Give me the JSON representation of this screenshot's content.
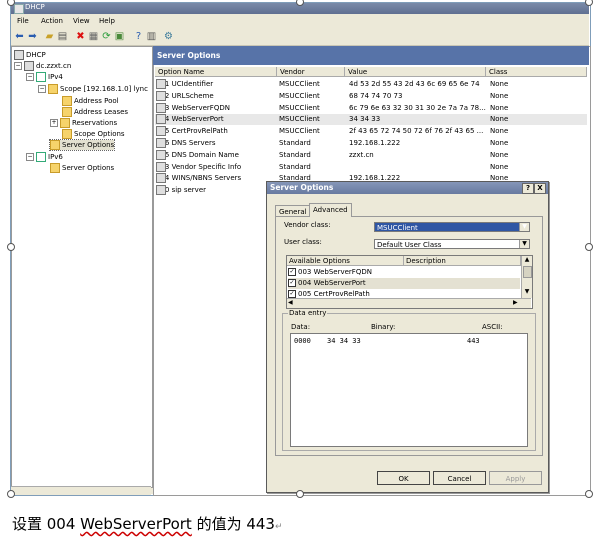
{
  "window": {
    "title": "DHCP"
  },
  "menu": [
    "File",
    "Action",
    "View",
    "Help"
  ],
  "toolbar_icons": [
    "back-arrow-icon",
    "forward-arrow-icon",
    "up-folder-icon",
    "show-hide-tree-icon",
    "delete-icon",
    "properties-icon",
    "refresh-icon",
    "export-icon",
    "help-icon",
    "console-icon",
    "options-icon"
  ],
  "tree": {
    "root": "DHCP",
    "server": "dc.zzxt.cn",
    "ipv4": "IPv4",
    "scope": "Scope [192.168.1.0] lync",
    "address_pool": "Address Pool",
    "address_leases": "Address Leases",
    "reservations": "Reservations",
    "scope_options": "Scope Options",
    "server_options_v4": "Server Options",
    "ipv6": "IPv6",
    "server_options_v6": "Server Options"
  },
  "pane": {
    "title": "Server Options",
    "columns": [
      "Option Name",
      "Vendor",
      "Value",
      "Class"
    ],
    "rows": [
      {
        "name": "001 UCIdentifier",
        "vendor": "MSUCClient",
        "value": "4d 53 2d 55 43 2d 43 6c 69 65 6e 74",
        "class": "None"
      },
      {
        "name": "002 URLScheme",
        "vendor": "MSUCClient",
        "value": "68 74 74 70 73",
        "class": "None"
      },
      {
        "name": "003 WebServerFQDN",
        "vendor": "MSUCClient",
        "value": "6c 79 6e 63 32 30 31 30 2e 7a 7a 78...",
        "class": "None"
      },
      {
        "name": "004 WebServerPort",
        "vendor": "MSUCClient",
        "value": "34 34 33",
        "class": "None"
      },
      {
        "name": "005 CertProvRelPath",
        "vendor": "MSUCClient",
        "value": "2f 43 65 72 74 50 72 6f 76 2f 43 65 ...",
        "class": "None"
      },
      {
        "name": "006 DNS Servers",
        "vendor": "Standard",
        "value": "192.168.1.222",
        "class": "None"
      },
      {
        "name": "015 DNS Domain Name",
        "vendor": "Standard",
        "value": "zzxt.cn",
        "class": "None"
      },
      {
        "name": "043 Vendor Specific Info",
        "vendor": "Standard",
        "value": "",
        "class": "None"
      },
      {
        "name": "044 WINS/NBNS Servers",
        "vendor": "Standard",
        "value": "192.168.1.222",
        "class": "None"
      },
      {
        "name": "120 sip server",
        "vendor": "",
        "value": "",
        "class": ""
      }
    ]
  },
  "dialog": {
    "title": "Server Options",
    "help_btn": "?",
    "close_btn": "X",
    "tabs": [
      "General",
      "Advanced"
    ],
    "vendor_class_label": "Vendor class:",
    "vendor_class_value": "MSUCClient",
    "user_class_label": "User class:",
    "user_class_value": "Default User Class",
    "options_headers": [
      "Available Options",
      "Description"
    ],
    "options": [
      {
        "label": "003 WebServerFQDN",
        "checked": true
      },
      {
        "label": "004 WebServerPort",
        "checked": true
      },
      {
        "label": "005 CertProvRelPath",
        "checked": true
      }
    ],
    "data_entry_legend": "Data entry",
    "data_label": "Data:",
    "binary_label": "Binary:",
    "ascii_label": "ASCII:",
    "data_offset": "0000",
    "data_binary": "34 34 33",
    "data_ascii": "443",
    "ok": "OK",
    "cancel": "Cancel",
    "apply": "Apply"
  },
  "caption": {
    "prefix": "设置 004 ",
    "underlined": "WebServerPort",
    "suffix": " 的值为 443"
  }
}
